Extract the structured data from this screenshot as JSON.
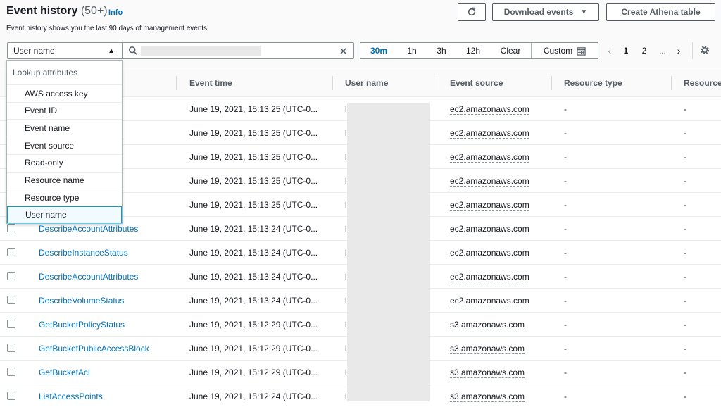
{
  "header": {
    "title": "Event history",
    "count": "(50+)",
    "info_label": "Info",
    "subtitle": "Event history shows you the last 90 days of management events.",
    "download_label": "Download events",
    "athena_label": "Create Athena table",
    "refresh_icon": "refresh-icon"
  },
  "filter": {
    "attribute_selected": "User name",
    "search_value": "",
    "time_ranges": [
      "30m",
      "1h",
      "3h",
      "12h"
    ],
    "active_range": "30m",
    "clear_label": "Clear",
    "custom_label": "Custom"
  },
  "pagination": {
    "pages": [
      "1",
      "2"
    ],
    "ellipsis": "...",
    "current_page": "1"
  },
  "dropdown": {
    "group_label": "Lookup attributes",
    "options": [
      "AWS access key",
      "Event ID",
      "Event name",
      "Event source",
      "Read-only",
      "Resource name",
      "Resource type",
      "User name"
    ],
    "selected": "User name"
  },
  "table": {
    "columns": [
      "Event time",
      "User name",
      "Event source",
      "Resource type",
      "Resource"
    ],
    "rows": [
      {
        "name": "",
        "time": "June 19, 2021, 15:13:25 (UTC-0...",
        "user": "l",
        "source": "ec2.amazonaws.com",
        "resource_type": "-",
        "resource": "-"
      },
      {
        "name": "",
        "time": "June 19, 2021, 15:13:25 (UTC-0...",
        "user": "l",
        "source": "ec2.amazonaws.com",
        "resource_type": "-",
        "resource": "-"
      },
      {
        "name": "nes",
        "time": "June 19, 2021, 15:13:25 (UTC-0...",
        "user": "l",
        "source": "ec2.amazonaws.com",
        "resource_type": "-",
        "resource": "-"
      },
      {
        "name": "",
        "time": "June 19, 2021, 15:13:25 (UTC-0...",
        "user": "l",
        "source": "ec2.amazonaws.com",
        "resource_type": "-",
        "resource": "-"
      },
      {
        "name": "ups",
        "time": "June 19, 2021, 15:13:25 (UTC-0...",
        "user": "l",
        "source": "ec2.amazonaws.com",
        "resource_type": "-",
        "resource": "-"
      },
      {
        "name": "DescribeAccountAttributes",
        "time": "June 19, 2021, 15:13:24 (UTC-0...",
        "user": "l",
        "source": "ec2.amazonaws.com",
        "resource_type": "-",
        "resource": "-"
      },
      {
        "name": "DescribeInstanceStatus",
        "time": "June 19, 2021, 15:13:24 (UTC-0...",
        "user": "l",
        "source": "ec2.amazonaws.com",
        "resource_type": "-",
        "resource": "-"
      },
      {
        "name": "DescribeAccountAttributes",
        "time": "June 19, 2021, 15:13:24 (UTC-0...",
        "user": "l",
        "source": "ec2.amazonaws.com",
        "resource_type": "-",
        "resource": "-"
      },
      {
        "name": "DescribeVolumeStatus",
        "time": "June 19, 2021, 15:13:24 (UTC-0...",
        "user": "l",
        "source": "ec2.amazonaws.com",
        "resource_type": "-",
        "resource": "-"
      },
      {
        "name": "GetBucketPolicyStatus",
        "time": "June 19, 2021, 15:12:29 (UTC-0...",
        "user": "l",
        "source": "s3.amazonaws.com",
        "resource_type": "-",
        "resource": "-"
      },
      {
        "name": "GetBucketPublicAccessBlock",
        "time": "June 19, 2021, 15:12:29 (UTC-0...",
        "user": "l",
        "source": "s3.amazonaws.com",
        "resource_type": "-",
        "resource": "-"
      },
      {
        "name": "GetBucketAcl",
        "time": "June 19, 2021, 15:12:29 (UTC-0...",
        "user": "l",
        "source": "s3.amazonaws.com",
        "resource_type": "-",
        "resource": "-"
      },
      {
        "name": "ListAccessPoints",
        "time": "June 19, 2021, 15:12:24 (UTC-0...",
        "user": "l",
        "source": "s3.amazonaws.com",
        "resource_type": "-",
        "resource": "-"
      }
    ]
  },
  "colors": {
    "link": "#0073bb",
    "text": "#16191f",
    "muted": "#545b64",
    "selected_border": "#00a1c9",
    "selected_bg": "#f1faff"
  }
}
